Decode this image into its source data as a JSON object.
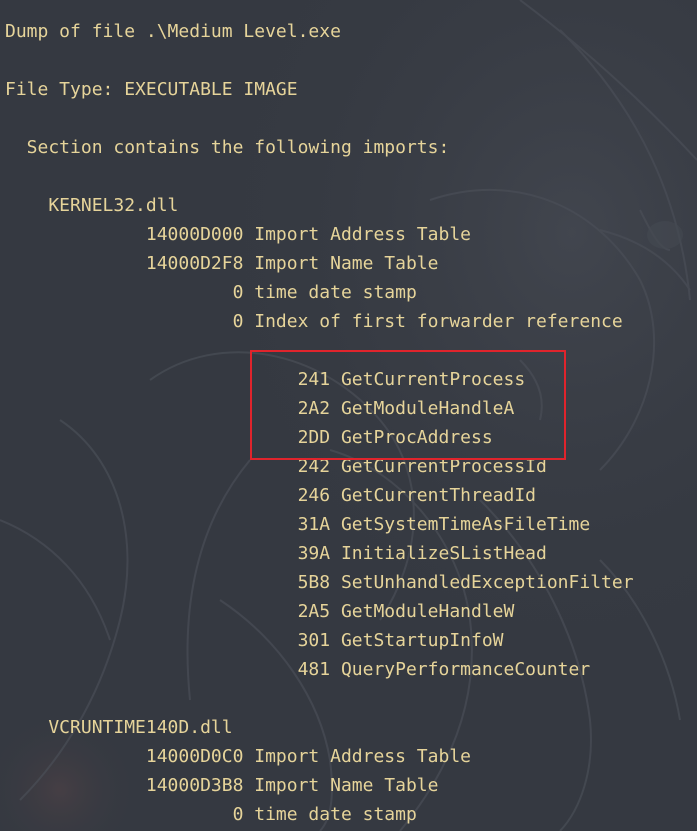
{
  "colors": {
    "background": "#353941",
    "text": "#e6d49a",
    "highlight": "#e0242c"
  },
  "dump": {
    "header": "Dump of file .\\Medium Level.exe",
    "file_type": "File Type: EXECUTABLE IMAGE",
    "section_intro": "  Section contains the following imports:",
    "dll1": {
      "name": "    KERNEL32.dll",
      "iat": "             14000D000 Import Address Table",
      "int": "             14000D2F8 Import Name Table",
      "timestamp": "                     0 time date stamp",
      "forwarder": "                     0 Index of first forwarder reference",
      "imports": [
        "                           241 GetCurrentProcess",
        "                           2A2 GetModuleHandleA",
        "                           2DD GetProcAddress",
        "                           242 GetCurrentProcessId",
        "                           246 GetCurrentThreadId",
        "                           31A GetSystemTimeAsFileTime",
        "                           39A InitializeSListHead",
        "                           5B8 SetUnhandledExceptionFilter",
        "                           2A5 GetModuleHandleW",
        "                           301 GetStartupInfoW",
        "                           481 QueryPerformanceCounter"
      ]
    },
    "dll2": {
      "name": "    VCRUNTIME140D.dll",
      "iat": "             14000D0C0 Import Address Table",
      "int": "             14000D3B8 Import Name Table",
      "timestamp": "                     0 time date stamp"
    }
  }
}
